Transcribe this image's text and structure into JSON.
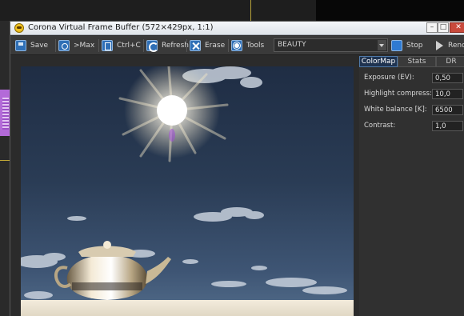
{
  "window": {
    "title": "Corona Virtual Frame Buffer (572×429px, 1:1)"
  },
  "toolbar": {
    "save_label": "Save",
    "max_label": ">Max",
    "copy_label": "Ctrl+C",
    "refresh_label": "Refresh",
    "erase_label": "Erase",
    "tools_label": "Tools",
    "pass_selected": "BEAUTY",
    "stop_label": "Stop",
    "render_label": "Rend"
  },
  "panel": {
    "tabs": [
      {
        "label": "ColorMap",
        "active": true
      },
      {
        "label": "Stats",
        "active": false
      },
      {
        "label": "DR",
        "active": false
      }
    ],
    "properties": [
      {
        "label": "Exposure (EV):",
        "value": "0,50"
      },
      {
        "label": "Highlight compress:",
        "value": "10,0"
      },
      {
        "label": "White balance [K]:",
        "value": "6500"
      },
      {
        "label": "Contrast:",
        "value": "1,0"
      }
    ]
  },
  "colors": {
    "accent": "#2f6fb6",
    "active_tab": "#1f3350",
    "titlebar": "#e6eaef",
    "render_bg": "#2b2b2b"
  },
  "icons": {
    "app": "corona-icon",
    "save": "save-icon",
    "max": "max-icon",
    "copy": "copy-icon",
    "refresh": "refresh-icon",
    "erase": "erase-icon",
    "tools": "gear-icon",
    "stop": "stop-icon",
    "render": "play-icon"
  }
}
